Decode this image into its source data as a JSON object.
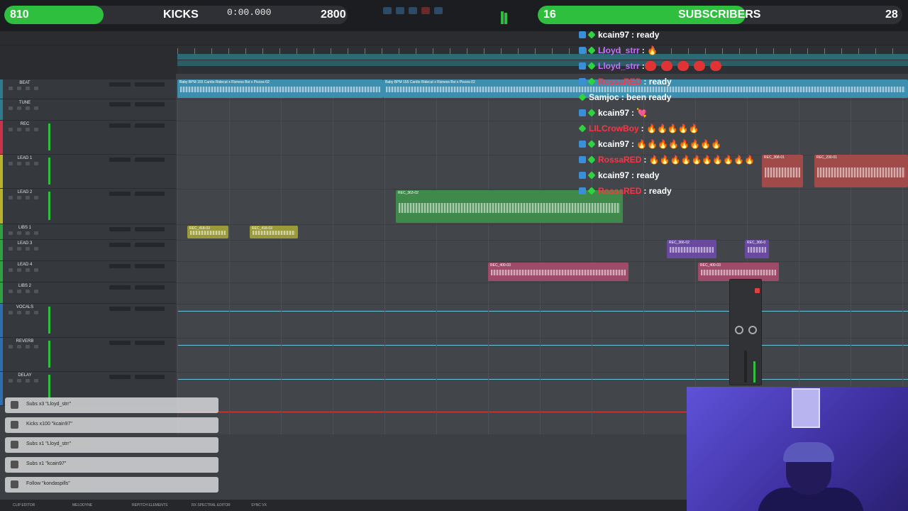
{
  "kicks_goal": {
    "count": "810",
    "label": "KICKS",
    "target": "2800",
    "progress": 0.29,
    "color": "#2fbf3f"
  },
  "subs_goal": {
    "count": "16",
    "label": "SUBSCRIBERS",
    "target": "28",
    "progress": 0.57,
    "color": "#2fbf3f"
  },
  "transport": {
    "counter": "0:00.000"
  },
  "tracks": [
    {
      "name": "BEAT",
      "color": "#2f7a8c"
    },
    {
      "name": "TUNE",
      "color": "#2f7a8c"
    },
    {
      "name": "REC",
      "color": "#c8324a"
    },
    {
      "name": "LEAD 1",
      "color": "#b9b22f"
    },
    {
      "name": "LEAD 2",
      "color": "#b9b22f"
    },
    {
      "name": "LIBS 1",
      "color": "#2fa043"
    },
    {
      "name": "LEAD 3",
      "color": "#2fa043"
    },
    {
      "name": "LEAD 4",
      "color": "#2fa043"
    },
    {
      "name": "LIBS 2",
      "color": "#2fa043"
    },
    {
      "name": "VOCALS",
      "color": "#2f6fb0"
    },
    {
      "name": "REVERB",
      "color": "#2f6fb0"
    },
    {
      "name": "DELAY",
      "color": "#2f6fb0"
    }
  ],
  "clips": [
    {
      "title": "Baby BPM 155 Cardio Ridecut x Rizness Boi x Pisces-02",
      "color": "#3d8fb0"
    },
    {
      "title": "Baby BPM 155 Cardio Ridecut x Rizness Boi x Pisces-02",
      "color": "#3d8fb0"
    },
    {
      "title": "REC_363-02",
      "color": "#3f8a4a"
    },
    {
      "title": "REC_418-03",
      "color": "#9a9a3a"
    },
    {
      "title": "REC_418-03",
      "color": "#9a9a3a"
    },
    {
      "title": "REC_400-03",
      "color": "#a04a6a"
    },
    {
      "title": "REC_366-02",
      "color": "#6a4aa0"
    },
    {
      "title": "REC_366-0",
      "color": "#6a4aa0"
    },
    {
      "title": "REC_400-03",
      "color": "#a04a6a"
    },
    {
      "title": "REC_368-01",
      "color": "#a04a4a"
    },
    {
      "title": "REC_230-01",
      "color": "#a04a4a"
    }
  ],
  "chat": [
    {
      "icons": [
        "blue",
        "green"
      ],
      "user": "kcain97",
      "user_color": "#ffffff",
      "msg": ": ready"
    },
    {
      "icons": [
        "blue",
        "green"
      ],
      "user": "Lloyd_strr",
      "user_color": "#c66bff",
      "msg": ": 🔥"
    },
    {
      "icons": [
        "blue",
        "green"
      ],
      "user": "Lloyd_strr",
      "user_color": "#c66bff",
      "msg": ":"
    },
    {
      "icons": [
        "blue",
        "green"
      ],
      "user": "RossaRED",
      "user_color": "#ff3344",
      "msg": ": ready"
    },
    {
      "icons": [
        "green"
      ],
      "user": "Samjoc",
      "user_color": "#ffffff",
      "msg": ": been ready"
    },
    {
      "icons": [
        "blue",
        "green"
      ],
      "user": "kcain97",
      "user_color": "#ffffff",
      "msg": ": 💘"
    },
    {
      "icons": [
        "green"
      ],
      "user": "LILCrowBoy",
      "user_color": "#ff3344",
      "msg": ": 🔥🔥🔥🔥🔥"
    },
    {
      "icons": [
        "blue",
        "green"
      ],
      "user": "kcain97",
      "user_color": "#ffffff",
      "msg": ": 🔥🔥🔥🔥🔥🔥🔥🔥"
    },
    {
      "icons": [
        "blue",
        "green"
      ],
      "user": "RossaRED",
      "user_color": "#ff3344",
      "msg": ": 🔥🔥🔥🔥🔥🔥🔥🔥🔥🔥"
    },
    {
      "icons": [
        "blue",
        "green"
      ],
      "user": "kcain97",
      "user_color": "#ffffff",
      "msg": ": ready"
    },
    {
      "icons": [
        "blue",
        "green"
      ],
      "user": "RossaRED",
      "user_color": "#ff3344",
      "msg": ": ready"
    }
  ],
  "alerts": [
    {
      "icon": "gift-icon",
      "text": "Subs x3 \"Lloyd_strr\""
    },
    {
      "icon": "kick-icon",
      "text": "Kicks x100 \"kcain97\""
    },
    {
      "icon": "gift-icon",
      "text": "Subs x1 \"Lloyd_strr\""
    },
    {
      "icon": "gift-icon",
      "text": "Subs x1 \"kcain97\""
    },
    {
      "icon": "heart-icon",
      "text": "Follow \"kondaspills\""
    }
  ],
  "bottom_tabs": [
    "CLIP EDITOR",
    "MELODYNE",
    "REPITCH ELEMENTS",
    "RX SPECTRAL EDITOR",
    "SYNC VX"
  ]
}
